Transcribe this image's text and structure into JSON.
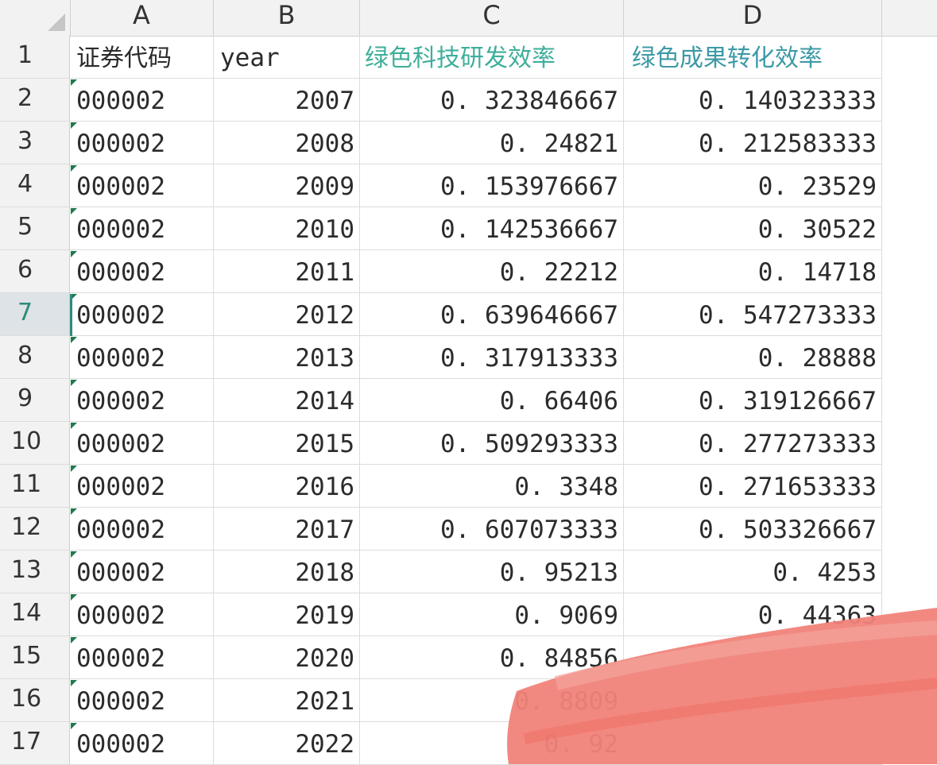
{
  "columns": [
    "A",
    "B",
    "C",
    "D"
  ],
  "header": {
    "code": "证券代码",
    "year": "year",
    "rd_eff": "绿色科技研发效率",
    "trans_eff": "绿色成果转化效率"
  },
  "rows": [
    {
      "num": "2",
      "code": "000002",
      "year": "2007",
      "c": "0.323846667",
      "d": "0.140323333"
    },
    {
      "num": "3",
      "code": "000002",
      "year": "2008",
      "c": "0.24821",
      "d": "0.212583333"
    },
    {
      "num": "4",
      "code": "000002",
      "year": "2009",
      "c": "0.153976667",
      "d": "0.23529"
    },
    {
      "num": "5",
      "code": "000002",
      "year": "2010",
      "c": "0.142536667",
      "d": "0.30522"
    },
    {
      "num": "6",
      "code": "000002",
      "year": "2011",
      "c": "0.22212",
      "d": "0.14718"
    },
    {
      "num": "7",
      "code": "000002",
      "year": "2012",
      "c": "0.639646667",
      "d": "0.547273333"
    },
    {
      "num": "8",
      "code": "000002",
      "year": "2013",
      "c": "0.317913333",
      "d": "0.28888"
    },
    {
      "num": "9",
      "code": "000002",
      "year": "2014",
      "c": "0.66406",
      "d": "0.319126667"
    },
    {
      "num": "10",
      "code": "000002",
      "year": "2015",
      "c": "0.509293333",
      "d": "0.277273333"
    },
    {
      "num": "11",
      "code": "000002",
      "year": "2016",
      "c": "0.3348",
      "d": "0.271653333"
    },
    {
      "num": "12",
      "code": "000002",
      "year": "2017",
      "c": "0.607073333",
      "d": "0.503326667"
    },
    {
      "num": "13",
      "code": "000002",
      "year": "2018",
      "c": "0.95213",
      "d": "0.4253"
    },
    {
      "num": "14",
      "code": "000002",
      "year": "2019",
      "c": "0.9069",
      "d": "0.44363"
    },
    {
      "num": "15",
      "code": "000002",
      "year": "2020",
      "c": "0.84856",
      "d": ""
    },
    {
      "num": "16",
      "code": "000002",
      "year": "2021",
      "c": "0.8809",
      "d": ""
    },
    {
      "num": "17",
      "code": "000002",
      "year": "2022",
      "c": "0.92",
      "d": ""
    }
  ],
  "active_row": "7",
  "colors": {
    "teal_header": "#3fae9b",
    "active_row_accent": "#2e8a7a",
    "redaction": "#f1837a"
  }
}
